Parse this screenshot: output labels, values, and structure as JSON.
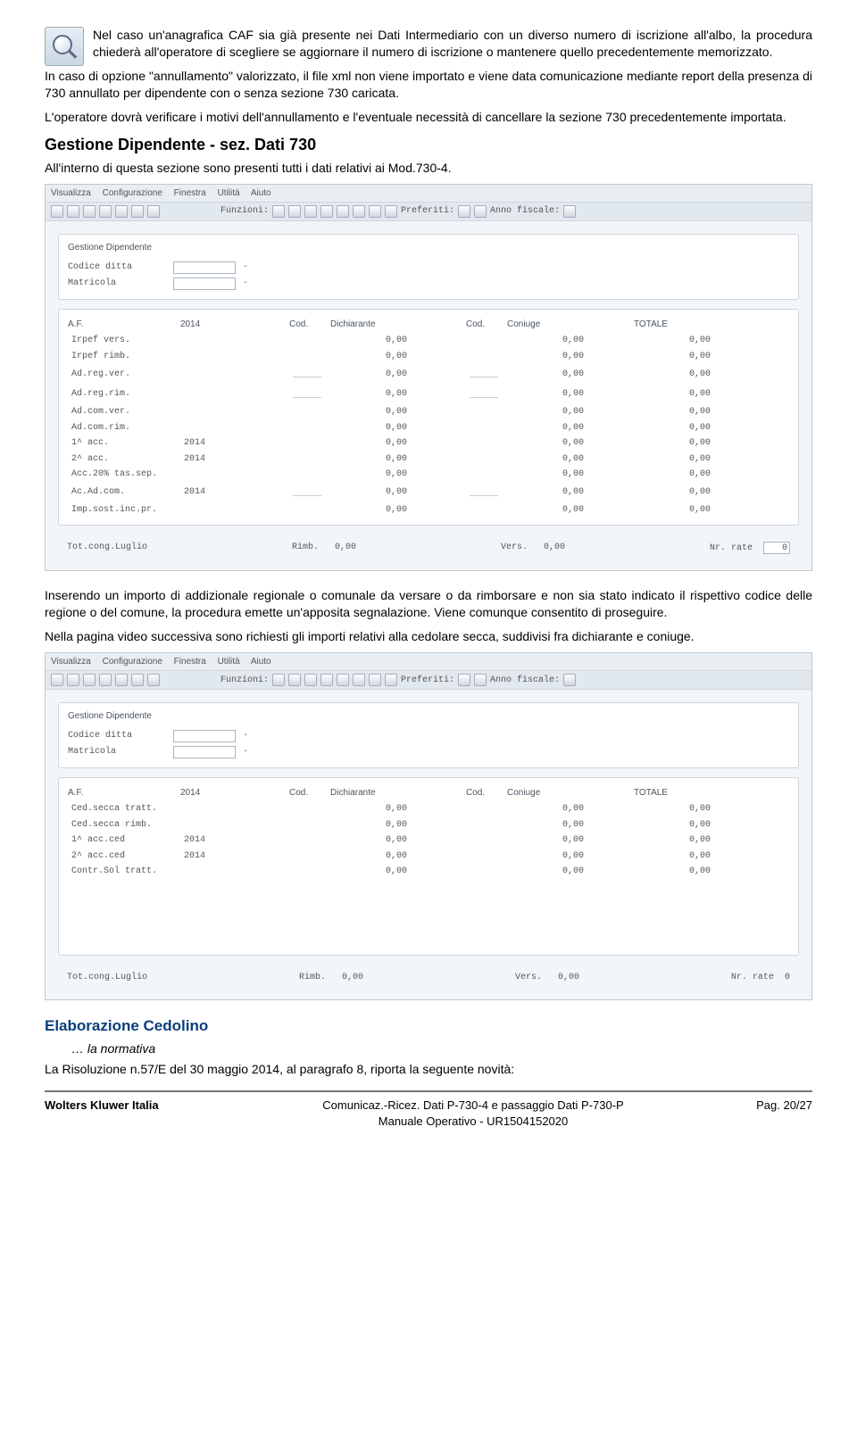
{
  "para1": "Nel caso un'anagrafica CAF sia già presente nei Dati Intermediario con un diverso numero di iscrizione all'albo, la procedura chiederà all'operatore di scegliere se aggiornare il numero di iscrizione o mantenere quello precedentemente memorizzato.",
  "para2": "In caso di opzione \"annullamento\" valorizzato, il file xml non viene importato e viene data comunicazione mediante report della presenza di 730 annullato per dipendente con o senza sezione 730 caricata.",
  "para3": "L'operatore dovrà verificare i motivi dell'annullamento e l'eventuale necessità di cancellare la sezione 730 precedentemente importata.",
  "h2a": "Gestione Dipendente - sez. Dati 730",
  "para4": "All'interno di questa sezione sono presenti tutti i dati relativi ai Mod.730-4.",
  "para5": "Inserendo un importo di addizionale regionale o comunale da versare o da rimborsare e non sia stato indicato il rispettivo codice delle regione o del comune, la procedura emette un'apposita segnalazione. Viene comunque consentito di proseguire.",
  "para6": "Nella pagina video successiva sono richiesti gli importi relativi alla cedolare secca, suddivisi fra dichiarante e coniuge.",
  "h3": "Elaborazione Cedolino",
  "italic": "… la normativa",
  "para7": "La Risoluzione n.57/E del 30 maggio 2014, al paragrafo 8, riporta la seguente novità:",
  "footer": {
    "left": "Wolters Kluwer Italia",
    "line1": "Comunicaz.-Ricez. Dati P-730-4 e passaggio Dati P-730-P",
    "line2": "Manuale Operativo - UR1504152020",
    "right": "Pag. 20/27"
  },
  "menubar": [
    "Visualizza",
    "Configurazione",
    "Finestra",
    "Utilità",
    "Aiuto"
  ],
  "toolbar": {
    "funzioni": "Funzioni:",
    "preferiti": "Preferiti:",
    "annofiscale": "Anno fiscale:"
  },
  "panelTitle": "Gestione Dipendente",
  "labels": {
    "codice": "Codice ditta",
    "matricola": "Matricola"
  },
  "headers": {
    "af": "A.F.",
    "year": "2014",
    "cod": "Cod.",
    "dich": "Dichiarante",
    "con": "Coniuge",
    "tot": "TOTALE"
  },
  "rows1": [
    {
      "l": "Irpef vers.",
      "y": ""
    },
    {
      "l": "Irpef rimb.",
      "y": ""
    },
    {
      "l": "Ad.reg.ver.",
      "y": ""
    },
    {
      "l": "Ad.reg.rim.",
      "y": ""
    },
    {
      "l": "Ad.com.ver.",
      "y": ""
    },
    {
      "l": "Ad.com.rim.",
      "y": ""
    },
    {
      "l": "1^ acc.",
      "y": "2014"
    },
    {
      "l": "2^ acc.",
      "y": "2014"
    },
    {
      "l": "Acc.20% tas.sep.",
      "y": ""
    },
    {
      "l": "Ac.Ad.com.",
      "y": "2014"
    },
    {
      "l": "Imp.sost.inc.pr.",
      "y": ""
    }
  ],
  "rows2": [
    {
      "l": "Ced.secca tratt.",
      "y": ""
    },
    {
      "l": "Ced.secca rimb.",
      "y": ""
    },
    {
      "l": "1^ acc.ced",
      "y": "2014"
    },
    {
      "l": "2^ acc.ced",
      "y": "2014"
    },
    {
      "l": "Contr.Sol tratt.",
      "y": ""
    }
  ],
  "zero": "0,00",
  "zeroInt": "0",
  "foot": {
    "tot": "Tot.cong.Luglio",
    "rimb": "Rimb.",
    "vers": "Vers.",
    "nr": "Nr. rate"
  }
}
